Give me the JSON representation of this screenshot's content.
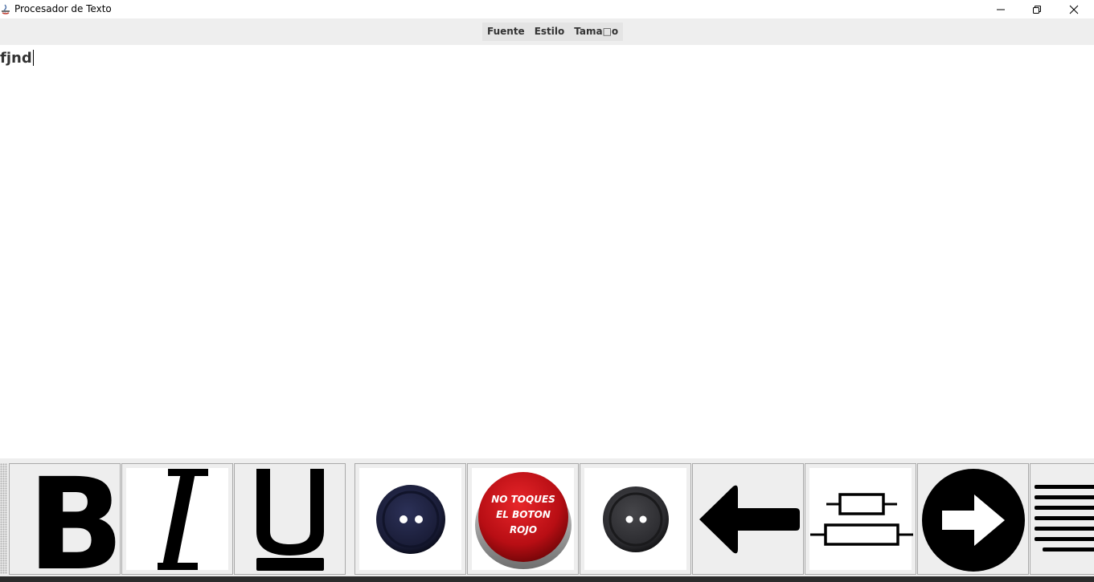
{
  "window": {
    "title": "Procesador de Texto",
    "controls": [
      "minimize",
      "maximize",
      "close"
    ]
  },
  "menu": {
    "items": [
      "Fuente",
      "Estilo",
      "Tama□o"
    ]
  },
  "editor": {
    "text": "fjnd"
  },
  "toolbar": {
    "buttons": [
      {
        "name": "bold-button",
        "icon": "bold-B-icon"
      },
      {
        "name": "italic-button",
        "icon": "italic-I-icon"
      },
      {
        "name": "underline-button",
        "icon": "underline-U-icon"
      },
      {
        "name": "navy-color-button",
        "icon": "navy-sewing-button-icon"
      },
      {
        "name": "red-button",
        "icon": "red-push-button-icon",
        "text": "NO TOQUES EL BOTON ROJO"
      },
      {
        "name": "black-color-button",
        "icon": "black-sewing-button-icon"
      },
      {
        "name": "align-left-button",
        "icon": "left-arrow-icon"
      },
      {
        "name": "align-center-button",
        "icon": "center-align-icon"
      },
      {
        "name": "align-right-button",
        "icon": "right-arrow-circle-icon"
      },
      {
        "name": "justify-button",
        "icon": "justify-lines-icon"
      }
    ],
    "red_button_lines": [
      "NO TOQUES",
      "EL BOTON",
      "ROJO"
    ]
  },
  "colors": {
    "menubar": "#eeeeee",
    "toolbar": "#eeeeee",
    "red_button": "#c8141a",
    "navy_button": "#1f2340",
    "black_button": "#2e2e31"
  }
}
